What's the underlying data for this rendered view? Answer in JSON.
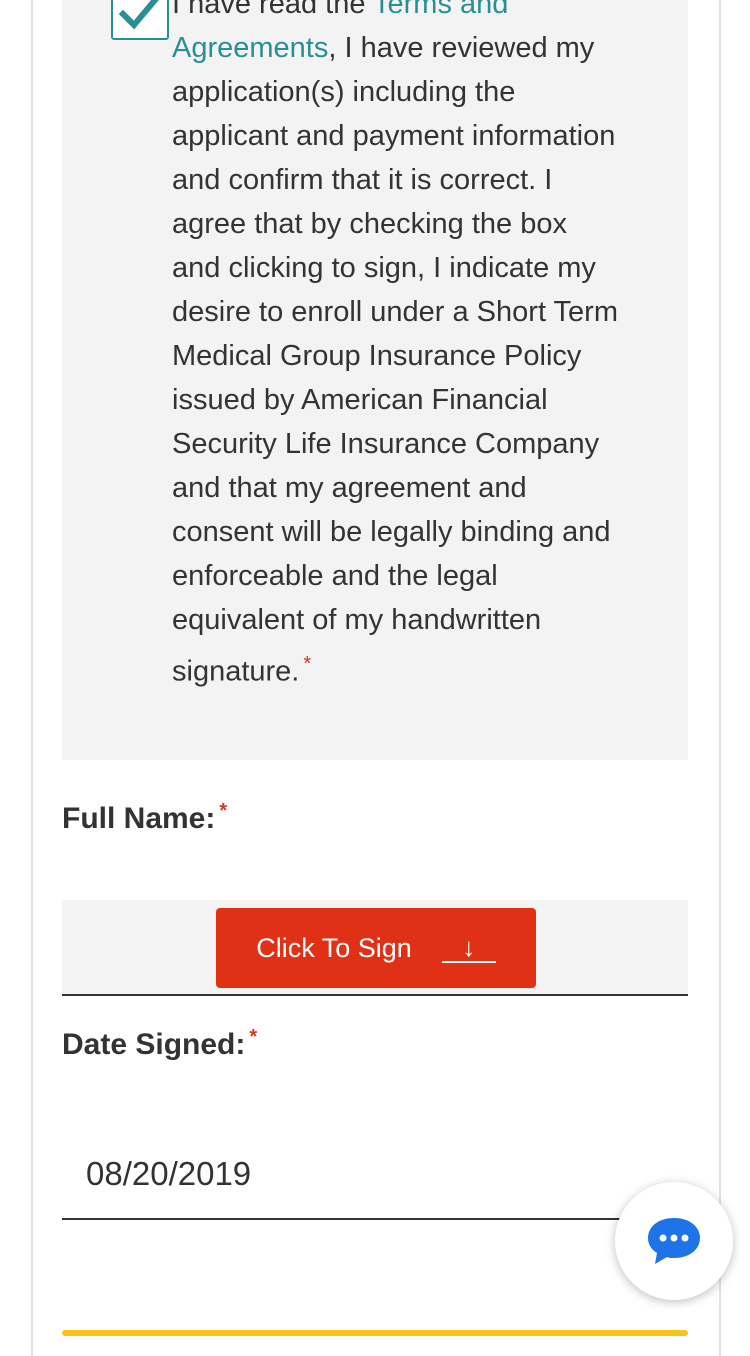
{
  "consent": {
    "checked": true,
    "text_before_link": "I have read the ",
    "link_text": "Terms and Agreements",
    "text_after_link": ", I have reviewed my application(s) including the applicant and payment information and confirm that it is correct. I agree that by checking the box and clicking to sign, I indicate my desire to enroll under a Short Term Medical Group Insurance Policy issued by American Financial Security Life Insurance Company and that my agreement and consent will be legally binding and enforceable and the legal equivalent of my handwritten signature.",
    "required_marker": "*"
  },
  "full_name": {
    "label": "Full Name:",
    "required_marker": "*",
    "sign_button_label": "Click To Sign",
    "sign_button_icon": "↓"
  },
  "date_signed": {
    "label": "Date Signed:",
    "required_marker": "*",
    "value": "08/20/2019"
  },
  "chat": {
    "icon": "chat-bubble-icon"
  },
  "colors": {
    "accent": "#2a8f93",
    "sign_button": "#e03116",
    "required": "#e0301e",
    "chat": "#1e73e8"
  }
}
